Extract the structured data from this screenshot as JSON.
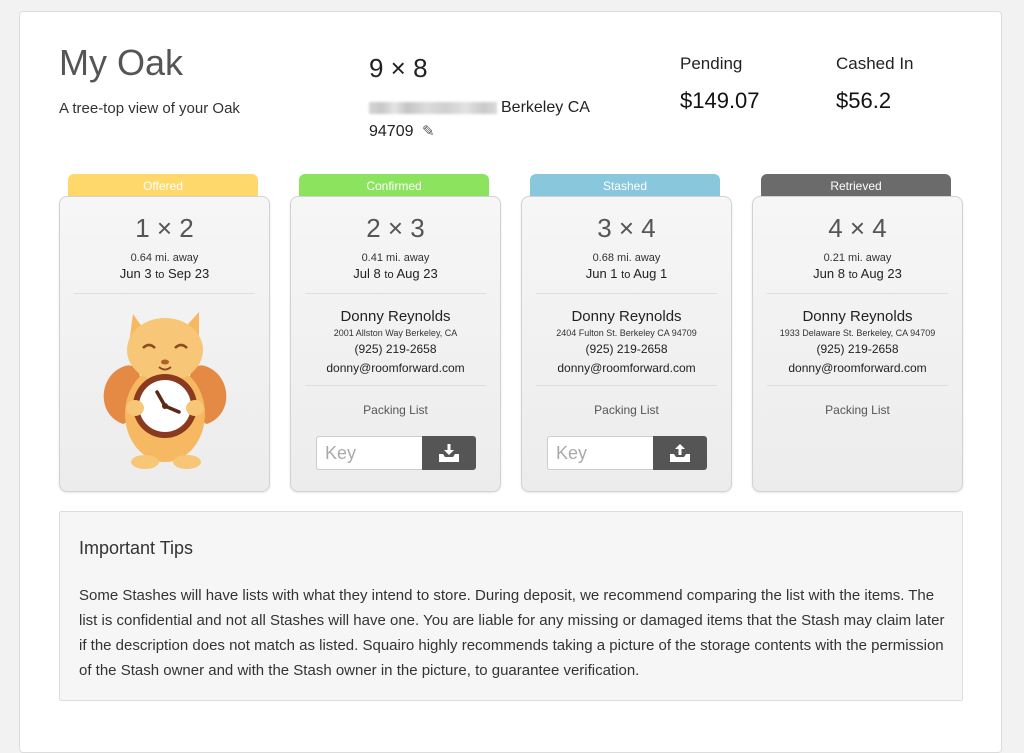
{
  "header": {
    "title": "My Oak",
    "subtitle": "A tree-top view of your Oak",
    "oak_size": "9 × 8",
    "address_city": "Berkeley CA",
    "address_zip": "94709",
    "edit_icon": "pencil-icon"
  },
  "stats": {
    "pending_label": "Pending",
    "pending_value": "$149.07",
    "cashed_label": "Cashed In",
    "cashed_value": "$56.2"
  },
  "colors": {
    "offered": "#fed86a",
    "confirmed": "#8ce45e",
    "stashed": "#88c7dc",
    "retrieved": "#6b6b6b",
    "squirrel": "#f6b860"
  },
  "to_word": "to",
  "packing_label": "Packing List",
  "key_placeholder": "Key",
  "cards": [
    {
      "status": "Offered",
      "size": "1 × 2",
      "distance": "0.64 mi. away",
      "start": "Jun 3",
      "end": "Sep 23",
      "illustration": "squirrel-clock"
    },
    {
      "status": "Confirmed",
      "size": "2 × 3",
      "distance": "0.41 mi. away",
      "start": "Jul 8",
      "end": "Aug 23",
      "contact_name": "Donny Reynolds",
      "street": "2001 Allston Way Berkeley, CA",
      "phone": "(925) 219-2658",
      "email": "donny@roomforward.com",
      "action_icon": "inbox-download-icon"
    },
    {
      "status": "Stashed",
      "size": "3 × 4",
      "distance": "0.68 mi. away",
      "start": "Jun 1",
      "end": "Aug 1",
      "contact_name": "Donny Reynolds",
      "street": "2404 Fulton St. Berkeley CA 94709",
      "phone": "(925) 219-2658",
      "email": "donny@roomforward.com",
      "action_icon": "inbox-upload-icon"
    },
    {
      "status": "Retrieved",
      "size": "4 × 4",
      "distance": "0.21 mi. away",
      "start": "Jun 8",
      "end": "Aug 23",
      "contact_name": "Donny Reynolds",
      "street": "1933 Delaware St. Berkeley, CA 94709",
      "phone": "(925) 219-2658",
      "email": "donny@roomforward.com"
    }
  ],
  "tips": {
    "heading": "Important Tips",
    "body": "Some Stashes will have lists with what they intend to store. During deposit, we recommend comparing the list with the items. The list is confidential and not all Stashes will have one. You are liable for any missing or damaged items that the Stash may claim later if the description does not match as listed. Squairo highly recommends taking a picture of the storage contents with the permission of the Stash owner and with the Stash owner in the picture, to guarantee verification."
  }
}
